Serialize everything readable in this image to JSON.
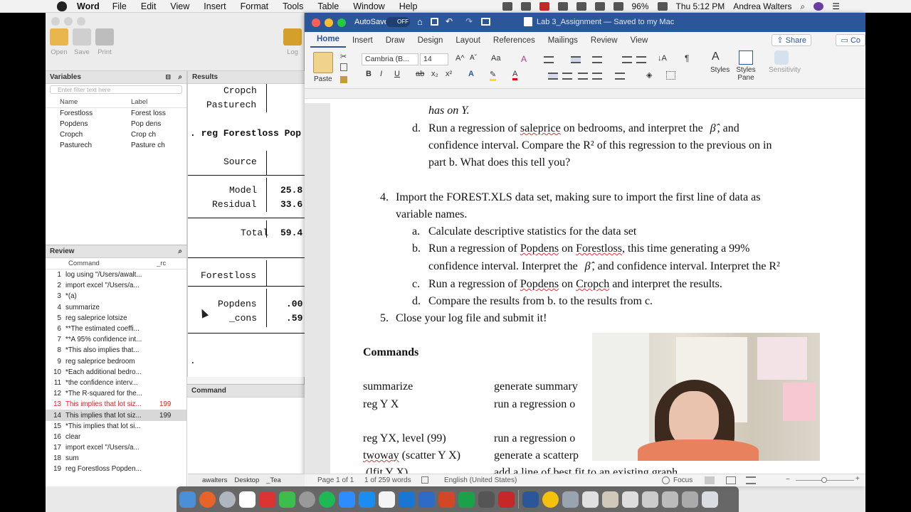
{
  "menubar": {
    "app": "Word",
    "items": [
      "File",
      "Edit",
      "View",
      "Insert",
      "Format",
      "Tools",
      "Table",
      "Window",
      "Help"
    ],
    "battery": "96%",
    "clock": "Thu 5:12 PM",
    "user": "Andrea Walters"
  },
  "stata": {
    "toolbar": {
      "open": "Open",
      "save": "Save",
      "print": "Print",
      "log": "Log"
    },
    "variables": {
      "title": "Variables",
      "filter_placeholder": "Enter filter text here",
      "col_name": "Name",
      "col_label": "Label",
      "rows": [
        {
          "name": "Forestloss",
          "label": "Forest loss"
        },
        {
          "name": "Popdens",
          "label": "Pop dens"
        },
        {
          "name": "Cropch",
          "label": "Crop ch"
        },
        {
          "name": "Pasturech",
          "label": "Pasture ch"
        }
      ]
    },
    "review": {
      "title": "Review",
      "col_cmd": "Command",
      "col_rc": "_rc",
      "rows": [
        {
          "n": "1",
          "t": "log using \"/Users/awalt...",
          "rc": ""
        },
        {
          "n": "2",
          "t": "import excel \"/Users/a...",
          "rc": ""
        },
        {
          "n": "3",
          "t": "*(a)",
          "rc": ""
        },
        {
          "n": "4",
          "t": "summarize",
          "rc": ""
        },
        {
          "n": "5",
          "t": "reg saleprice lotsize",
          "rc": ""
        },
        {
          "n": "6",
          "t": "**The estimated coeffi...",
          "rc": ""
        },
        {
          "n": "7",
          "t": "**A 95% confidence int...",
          "rc": ""
        },
        {
          "n": "8",
          "t": "*This also implies that...",
          "rc": ""
        },
        {
          "n": "9",
          "t": "reg saleprice bedroom",
          "rc": ""
        },
        {
          "n": "10",
          "t": "*Each additional bedro...",
          "rc": ""
        },
        {
          "n": "11",
          "t": "*the confidence interv...",
          "rc": ""
        },
        {
          "n": "12",
          "t": "*The R-squared for the...",
          "rc": ""
        },
        {
          "n": "13",
          "t": "This implies that lot siz...",
          "rc": "199"
        },
        {
          "n": "14",
          "t": "This implies that lot siz...",
          "rc": "199"
        },
        {
          "n": "15",
          "t": "*This implies that lot si...",
          "rc": ""
        },
        {
          "n": "16",
          "t": "clear",
          "rc": ""
        },
        {
          "n": "17",
          "t": "import excel \"/Users/a...",
          "rc": ""
        },
        {
          "n": "18",
          "t": "sum",
          "rc": ""
        },
        {
          "n": "19",
          "t": "reg Forestloss Popden...",
          "rc": ""
        }
      ]
    },
    "results": {
      "title": "Results",
      "lines": {
        "l1": "Cropch",
        "l2": "Pasturech",
        "l3": ". reg Forestloss Pop",
        "l4": "Source",
        "l5": "Model",
        "l5v": "25.8",
        "l6": "Residual",
        "l6v": "33.6",
        "l7": "Total",
        "l7v": "59.4",
        "l8": "Forestloss",
        "l9": "Popdens",
        "l9v": ".00",
        "l10": "_cons",
        "l10v": ".59",
        "l11": "."
      }
    },
    "command": {
      "title": "Command"
    }
  },
  "word": {
    "autosave": "AutoSave",
    "autosave_state": "OFF",
    "title": "Lab 3_Assignment — Saved to my Mac",
    "tabs": [
      "Home",
      "Insert",
      "Draw",
      "Design",
      "Layout",
      "References",
      "Mailings",
      "Review",
      "View"
    ],
    "share": "Share",
    "comments": "Co",
    "ribbon": {
      "paste": "Paste",
      "font": "Cambria (B...",
      "size": "14",
      "styles": "Styles",
      "styles_pane": "Styles Pane",
      "sensitivity": "Sensitivity"
    },
    "doc": {
      "l0": "has on Y.",
      "d_label": "d.",
      "d1a": "Run a regression of ",
      "d1b": "saleprice",
      "d1c": " on bedrooms, and interpret the",
      "d1d": "β̂",
      "d1e": ", and",
      "d2": "confidence interval.  Compare the R² of this regression to the previous on in",
      "d3": "part b.  What does this tell you?",
      "q4_label": "4.",
      "q4a": "Import the FOREST.XLS data set, making sure to import the first line of data as",
      "q4b": "variable names.",
      "a_label": "a.",
      "a1": "Calculate descriptive statistics for the data set",
      "b_label": "b.",
      "b1a": "Run a regression of ",
      "b1b": "Popdens",
      "b1c": " on ",
      "b1d": "Forestloss",
      "b1e": ", this time generating a 99%",
      "b2a": "confidence interval.  Interpret the",
      "b2b": "β̂",
      "b2c": ", and confidence interval.  Interpret the R²",
      "c_label": "c.",
      "c1a": "Run a regression of ",
      "c1b": "Popdens",
      "c1c": " on ",
      "c1d": "Cropch",
      "c1e": " and interpret the results.",
      "d2_label": "d.",
      "dd1": "Compare the results from b. to the results from c.",
      "q5_label": "5.",
      "q5": "Close your log file and submit it!",
      "commands_heading": "Commands",
      "cmd1": "summarize",
      "cmd1d": "generate summary",
      "cmd2": "reg Y X",
      "cmd2d": "run a regression o",
      "cmd3": "reg YX, level (99)",
      "cmd3d": "run a regression o",
      "cmd4a": "twoway",
      "cmd4b": " (scatter Y X)",
      "cmd4d": "generate a scatterp",
      "cmd5": "(lfit Y X)",
      "cmd5d": "add a line of best fit to an existing graph"
    },
    "status": {
      "page": "Page 1 of 1",
      "words": "1 of 259 words",
      "lang": "English (United States)",
      "focus": "Focus"
    }
  },
  "finder_tabs": [
    "awalters",
    "Desktop",
    "_Tea"
  ],
  "colors": {
    "word_blue": "#2b579a",
    "error_red": "#dd2222"
  }
}
